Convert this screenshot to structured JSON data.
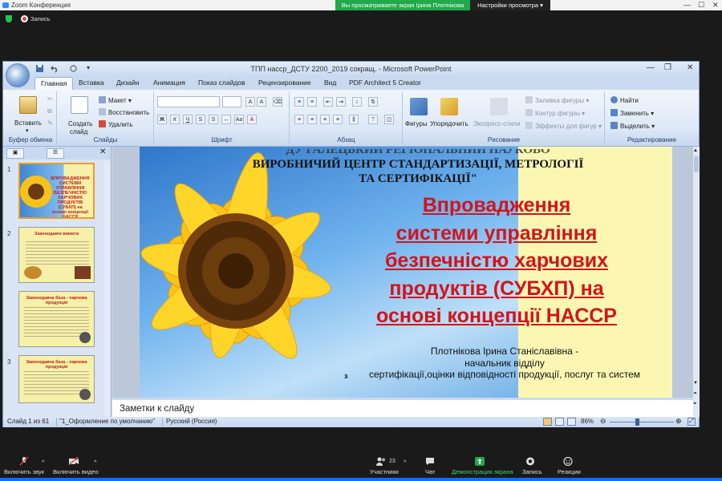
{
  "zoom": {
    "title": "Zoom Конференция",
    "share_banner": "Вы просматриваете экран Ірина Плотнікова",
    "view_options": "Настройки просмотра",
    "recording": "Запись",
    "controls": [
      {
        "label": "Включить звук",
        "icon": "mic-muted-icon"
      },
      {
        "label": "Включить видео",
        "icon": "video-off-icon"
      },
      {
        "label": "Участники",
        "icon": "participants-icon",
        "count": "23"
      },
      {
        "label": "Чат",
        "icon": "chat-icon"
      },
      {
        "label": "Демонстрация экрана",
        "icon": "share-screen-icon"
      },
      {
        "label": "Запись",
        "icon": "record-icon"
      },
      {
        "label": "Реакции",
        "icon": "reactions-icon"
      }
    ]
  },
  "ppt": {
    "title": "ТПП нассp_ДСТУ 2200_2019 сокращ. - Microsoft PowerPoint",
    "tabs": [
      "Главная",
      "Вставка",
      "Дизайн",
      "Анимация",
      "Показ слайдов",
      "Рецензирование",
      "Вид",
      "PDF Architect 5 Creator"
    ],
    "groups": {
      "clipboard": {
        "label": "Буфер обмена",
        "paste": "Вставить"
      },
      "slides": {
        "label": "Слайды",
        "create": "Создать",
        "create2": "слайд",
        "layout": "Макет",
        "reset": "Восстановить",
        "delete": "Удалить"
      },
      "font": {
        "label": "Шрифт"
      },
      "paragraph": {
        "label": "Абзац"
      },
      "drawing": {
        "label": "Рисование",
        "shapes": "Фигуры",
        "arrange": "Упорядочить",
        "styles": "Экспресс-стили",
        "fill": "Заливка фигуры",
        "outline": "Контур фигуры",
        "effects": "Эффекты для фигур"
      },
      "editing": {
        "label": "Редактирование",
        "find": "Найти",
        "replace": "Заменить",
        "select": "Выделить"
      }
    },
    "thumbnails": [
      {
        "num": "1",
        "title": "ВПРОВАДЖЕННЯ СИСТЕМИ УПРАВЛІННЯ БЕЗПЕЧНІСТЮ ХАРЧОВИХ ПРОДУКТІВ (СУБХП) на основі концепції НАССР"
      },
      {
        "num": "2",
        "title": "Законодавчі вимоги"
      },
      {
        "num": "3",
        "title": "Законодавча база - харчова продукція"
      },
      {
        "num": "4",
        "title": "Законодавча база - харчова продукція"
      }
    ],
    "slide": {
      "org_line0": "ДУ ГАЛЕЦЬКИЙ РЕГІОНАЛЬНИЙ НАУКОВО",
      "org_line1": "ВИРОБНИЧИЙ ЦЕНТР СТАНДАРТИЗАЦІЇ, МЕТРОЛОГІЇ",
      "org_line2": "ТА СЕРТИФІКАЦІЇ\"",
      "title_lines": [
        "Впровадження",
        "системи управління",
        "безпечністю  харчових",
        "продуктів (СУБХП) на",
        "основі концепції НАССР"
      ],
      "author": "Плотнікова Ірина Станіславівна -",
      "position": "начальник  відділу",
      "dept": "сертифікації,оцінки  відповідності  продукції, послуг та систем",
      "num_mark": "з"
    },
    "notes_placeholder": "Заметки к слайду",
    "status": {
      "slide": "Слайд 1 из 61",
      "theme": "\"1_Оформление по умолчанию\"",
      "lang": "Русский (Россия)",
      "zoom": "86%"
    }
  }
}
